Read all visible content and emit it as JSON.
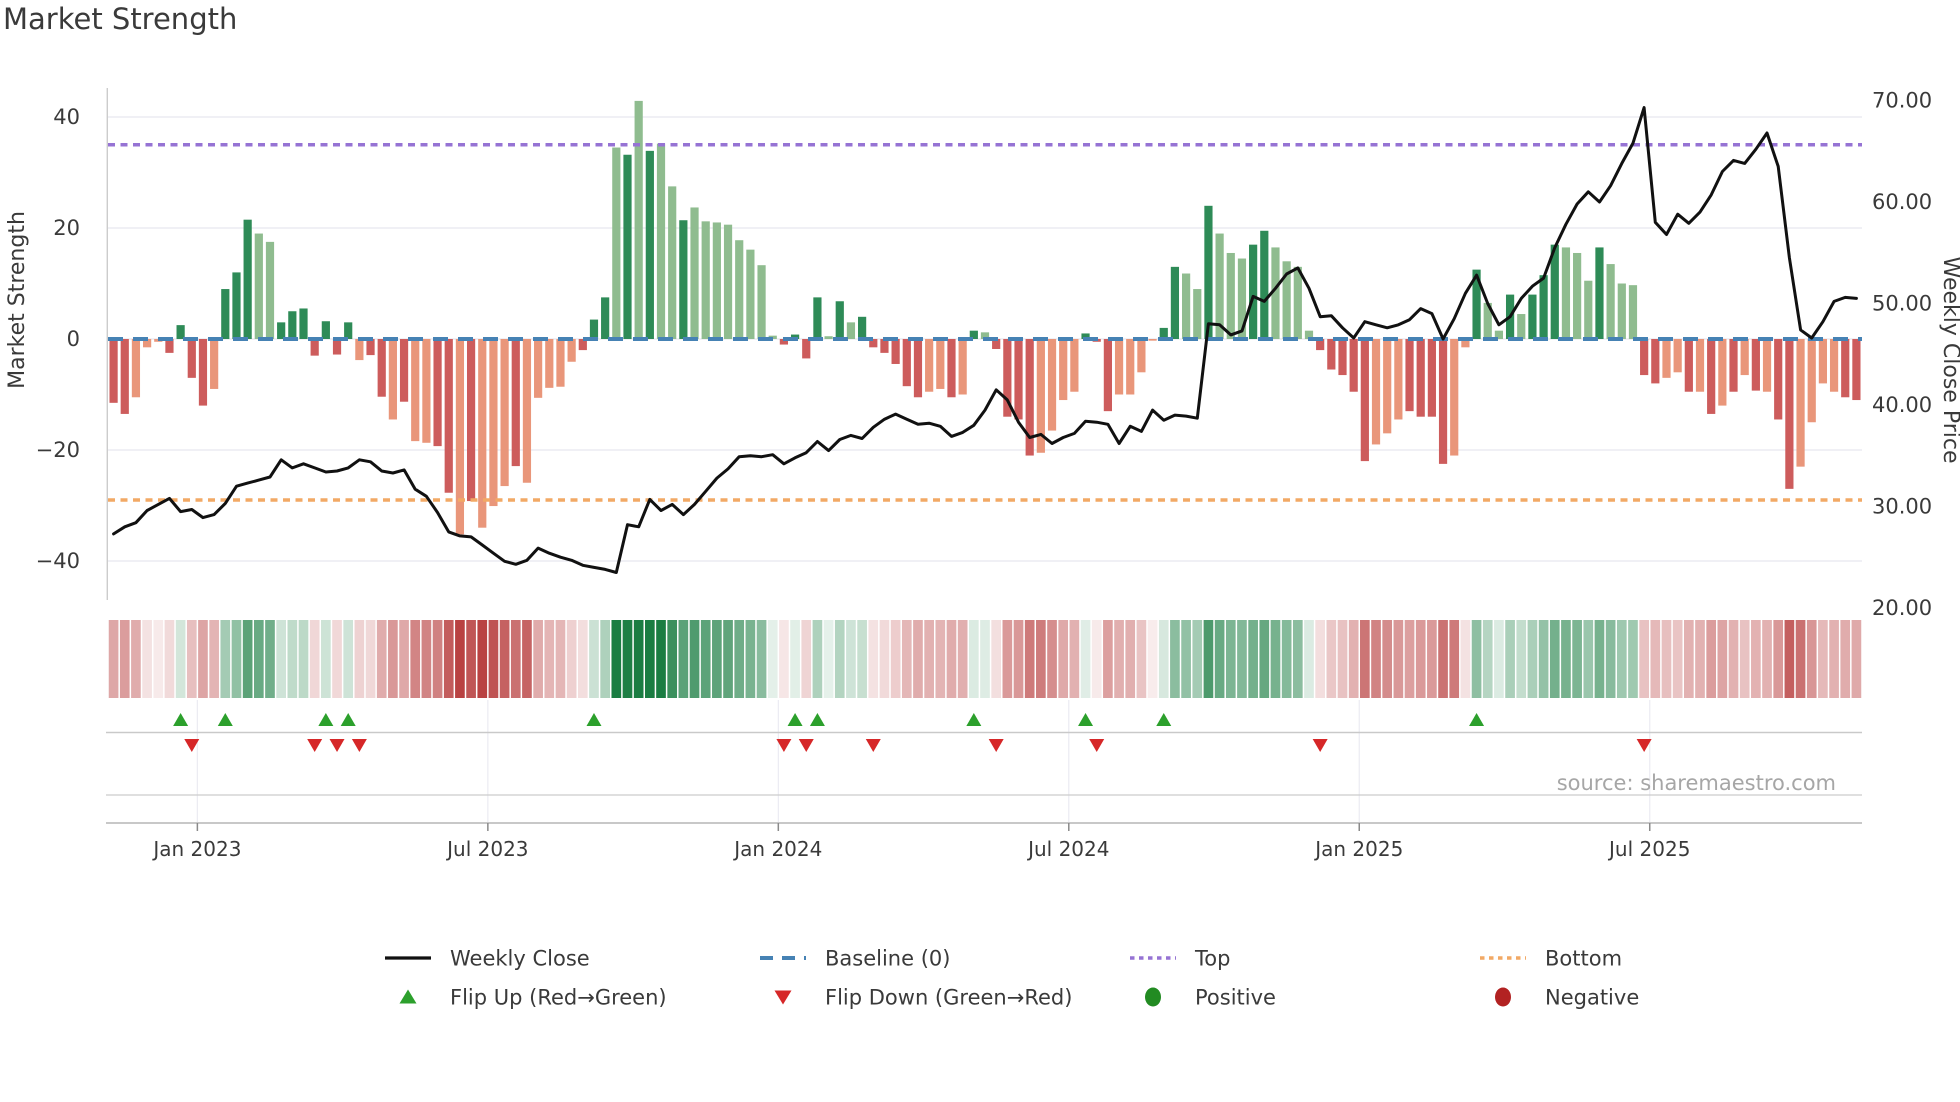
{
  "title": "Market Strength",
  "source_note": "source: sharemaestro.com",
  "colors": {
    "bar_pos_dark": "#2e8b57",
    "bar_pos_light": "#8fbc8f",
    "bar_neg_dark": "#cd5c5c",
    "bar_neg_light": "#e9967a",
    "baseline": "#4682b4",
    "top_line": "#9673d4",
    "bottom_line": "#f2a965",
    "price_line": "#111111",
    "flip_up": "#2ca02c",
    "flip_down": "#d62728",
    "positive_dot": "#228b22",
    "negative_dot": "#b22222",
    "grid": "#ebebf2",
    "spine": "#cccccc",
    "axis_line": "#b5b5b5",
    "tick_text": "#3a3a3a",
    "source_text": "#a6a6a6",
    "strip_pos_full": "#1a7d42",
    "strip_neg_full": "#b94242"
  },
  "chart_data": {
    "type": "bar+line",
    "title": "Market Strength",
    "weeks": 157,
    "left_axis": {
      "label": "Market Strength",
      "ticks": [
        -40,
        -20,
        0,
        20,
        40
      ],
      "range": [
        -46,
        46
      ]
    },
    "right_axis": {
      "label": "Weekly Close Price",
      "tick_labels": [
        "70.00",
        "60.00",
        "50.00",
        "40.00",
        "30.00",
        "20.00"
      ],
      "tick_values": [
        70,
        60,
        50,
        40,
        30,
        20
      ],
      "range": [
        20,
        70
      ]
    },
    "x_ticks": [
      {
        "label": "Jan 2023",
        "week": 8
      },
      {
        "label": "Jul 2023",
        "week": 34
      },
      {
        "label": "Jan 2024",
        "week": 60
      },
      {
        "label": "Jul 2024",
        "week": 86
      },
      {
        "label": "Jan 2025",
        "week": 112
      },
      {
        "label": "Jul 2025",
        "week": 138
      }
    ],
    "baseline": 0,
    "top_threshold": 35,
    "bottom_threshold": -29,
    "strength_bars": [
      -11.5,
      -13.5,
      -10.5,
      -1.5,
      -0.5,
      -2.5,
      2.5,
      -7,
      -12,
      -9,
      9,
      12,
      21.5,
      19,
      17.5,
      3,
      5,
      5.5,
      -3,
      3.2,
      -2.8,
      3,
      -3.8,
      -2.9,
      -10.4,
      -14.5,
      -11.3,
      -18.4,
      -18.7,
      -19.3,
      -27.7,
      -35.2,
      -29.2,
      -34,
      -30.1,
      -26.5,
      -22.9,
      -25.9,
      -10.6,
      -8.8,
      -8.6,
      -4.1,
      -2,
      3.5,
      7.5,
      34.5,
      33.2,
      42.9,
      33.9,
      35.2,
      27.5,
      21.4,
      23.7,
      21.2,
      21,
      20.6,
      17.8,
      16.1,
      13.3,
      0.6,
      -1,
      0.8,
      -3.5,
      7.5,
      0.5,
      6.8,
      3,
      4,
      -1.5,
      -2.5,
      -4.5,
      -8.5,
      -10.5,
      -9.5,
      -9,
      -10.5,
      -10,
      1.5,
      1.2,
      -1.8,
      -14,
      -14.5,
      -21,
      -20.5,
      -16.5,
      -11,
      -9.5,
      1,
      -0.5,
      -13,
      -10,
      -10,
      -6,
      -0.3,
      2,
      13,
      11.8,
      9,
      24,
      19,
      15.5,
      14.5,
      17,
      19.5,
      16.5,
      14,
      13,
      1.5,
      -2,
      -5.5,
      -6.5,
      -9.5,
      -22,
      -19,
      -17,
      -14.5,
      -13,
      -14,
      -14,
      -22.5,
      -21,
      -1.5,
      12.5,
      6.5,
      1.5,
      8,
      4.5,
      8,
      11.5,
      17,
      16.5,
      15.5,
      10.5,
      16.5,
      13.5,
      10,
      9.7,
      -6.5,
      -8,
      -7,
      -6,
      -9.5,
      -9.5,
      -13.5,
      -12,
      -9.5,
      -6.5,
      -9.3,
      -9.5,
      -14.5,
      -27,
      -23,
      -15,
      -8,
      -9.5,
      -10.5,
      -11
    ],
    "bar_tones": "ddlllddddldddlldddddddlddldllddldllldllllldddldldlldllllllllddddldldd ddddlldldlddddllllddd llllddlldlllddllllddd ddllldddd lldlldldddllldlllddlldldldldld dlllldd",
    "weekly_close": [
      27.3,
      28,
      28.4,
      29.6,
      30.2,
      30.8,
      29.5,
      29.7,
      28.9,
      29.2,
      30.3,
      32,
      32.3,
      32.6,
      32.9,
      34.6,
      33.8,
      34.2,
      33.8,
      33.4,
      33.5,
      33.8,
      34.6,
      34.4,
      33.5,
      33.3,
      33.6,
      31.7,
      31,
      29.4,
      27.5,
      27.1,
      27,
      26.2,
      25.4,
      24.6,
      24.3,
      24.7,
      25.9,
      25.4,
      25,
      24.7,
      24.2,
      24,
      23.8,
      23.5,
      28.2,
      28,
      30.7,
      29.6,
      30.2,
      29.2,
      30.2,
      31.5,
      32.8,
      33.7,
      34.9,
      35,
      34.9,
      35.1,
      34.2,
      34.8,
      35.3,
      36.4,
      35.5,
      36.6,
      37,
      36.7,
      37.8,
      38.6,
      39.1,
      38.6,
      38.1,
      38.2,
      37.9,
      36.9,
      37.3,
      38,
      39.5,
      41.5,
      40.5,
      38.3,
      36.8,
      37.1,
      36.2,
      36.8,
      37.2,
      38.4,
      38.3,
      38.1,
      36.2,
      37.9,
      37.4,
      39.5,
      38.5,
      39,
      38.9,
      38.7,
      48,
      47.9,
      46.9,
      47.3,
      50.7,
      50.2,
      51.5,
      52.9,
      53.5,
      51.5,
      48.7,
      48.8,
      47.6,
      46.6,
      48.2,
      47.9,
      47.6,
      47.9,
      48.4,
      49.5,
      49,
      46.5,
      48.5,
      51,
      52.8,
      50,
      47.9,
      48.7,
      50.5,
      51.7,
      52.5,
      55.5,
      57.8,
      59.8,
      61,
      60,
      61.6,
      63.8,
      65.8,
      69.3,
      58,
      56.8,
      58.8,
      57.9,
      59,
      60.7,
      63,
      64.1,
      63.8,
      65.2,
      66.8,
      63.5,
      54.5,
      47.4,
      46.6,
      48.2,
      50.2,
      50.6,
      50.5
    ],
    "flip_up_weeks": [
      6,
      10,
      19,
      21,
      43,
      61,
      63,
      77,
      87,
      94,
      122
    ],
    "flip_down_weeks": [
      7,
      18,
      20,
      22,
      60,
      62,
      68,
      79,
      88,
      108,
      137
    ],
    "grid": true,
    "legend_position": "bottom"
  },
  "legend": {
    "items": [
      {
        "name": "weekly-close",
        "label": "Weekly Close",
        "swatch": "line",
        "color_key": "price_line"
      },
      {
        "name": "baseline",
        "label": "Baseline (0)",
        "swatch": "dashes",
        "color_key": "baseline"
      },
      {
        "name": "top",
        "label": "Top",
        "swatch": "dots",
        "color_key": "top_line"
      },
      {
        "name": "bottom",
        "label": "Bottom",
        "swatch": "dots",
        "color_key": "bottom_line"
      },
      {
        "name": "flip-up",
        "label": "Flip Up (Red→Green)",
        "swatch": "triangle-up",
        "color_key": "flip_up"
      },
      {
        "name": "flip-down",
        "label": "Flip Down (Green→Red)",
        "swatch": "triangle-down",
        "color_key": "flip_down"
      },
      {
        "name": "positive",
        "label": "Positive",
        "swatch": "circle",
        "color_key": "positive_dot"
      },
      {
        "name": "negative",
        "label": "Negative",
        "swatch": "circle",
        "color_key": "negative_dot"
      }
    ]
  }
}
